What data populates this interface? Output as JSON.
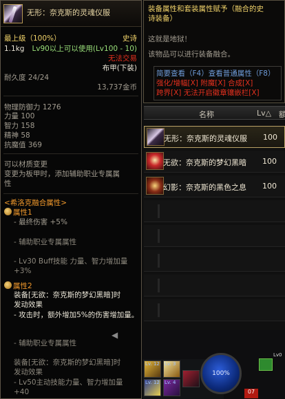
{
  "tooltip": {
    "title": "无形：奈克斯的灵魂仪服",
    "level_label": "最上级（100%）",
    "rarity": "史诗",
    "weight": "1.1kg",
    "level_req": "Lv90以上可以使用(Lv100 - 10)",
    "trade": "无法交易",
    "type": "布甲(下装)",
    "durability": "耐久度 24/24",
    "price": "13,737金币",
    "stats": [
      "物理防御力 1276",
      "力量 100",
      "智力 158",
      "精神 58",
      "抗魔值 369"
    ],
    "material_change": "可以材质变更",
    "material_note_1": "变更为板甲时，添加辅助职业专属属",
    "material_note_2": "性",
    "fusion_title": "<希洛克融合属性>",
    "attr1_title": "属性1",
    "attr1_lines": [
      "- 最终伤害 +5%",
      "- 辅助职业专属属性",
      "- Lv30 Buff技能 力量、智力增加量",
      "+3%"
    ],
    "attr2_title": "属性2",
    "attr2_lines": [
      "装备[无欲：奈克斯的梦幻黑暗]时",
      "发动效果",
      "- 攻击时，额外增加5%的伤害增加量。",
      "- 辅助职业专属属性",
      "装备[无欲：奈克斯的梦幻黑暗]时",
      "发动效果",
      "- Lv50主动技能力量、智力增加量",
      "+40"
    ]
  },
  "info": {
    "header_line1": "装备属性和套装属性赋予（融合的史",
    "header_line2": "诗装备）",
    "line_hell": "这就是地狱！",
    "line_fusion": "该物品可以进行装备融合。",
    "opt1": "简要查看（F4）查看普通属性（F8）",
    "opt2": "强化/增幅[X]  附魔[X]  合成[X]",
    "opt3": "跨界[X]  无法开启徽章镶嵌栏[X]"
  },
  "list": {
    "col_name": "名称",
    "col_lv": "Lv△",
    "col_extra": "额",
    "rows": [
      {
        "name": "无形：奈克斯的灵魂仪服",
        "lv": "100",
        "icon": "robe-icon"
      },
      {
        "name": "无欲：奈克斯的梦幻黑暗",
        "lv": "100",
        "icon": "dark-dream-icon"
      },
      {
        "name": "幻影：奈克斯的黑色之息",
        "lv": "100",
        "icon": "black-breath-icon"
      }
    ]
  },
  "hud": {
    "orb_percent": "100%",
    "count_07": "07",
    "skill_levels": [
      "Lv. 12",
      "Lv. 3",
      "Lv. 12",
      "Lv. 4"
    ],
    "lv_tag": "Lv0"
  },
  "colors": {
    "accent_gold": "#f1d36a",
    "epic": "#f1d36a",
    "untradeable": "#e3301e",
    "requirement": "#9ae07a",
    "fusion": "#f39a2c"
  }
}
